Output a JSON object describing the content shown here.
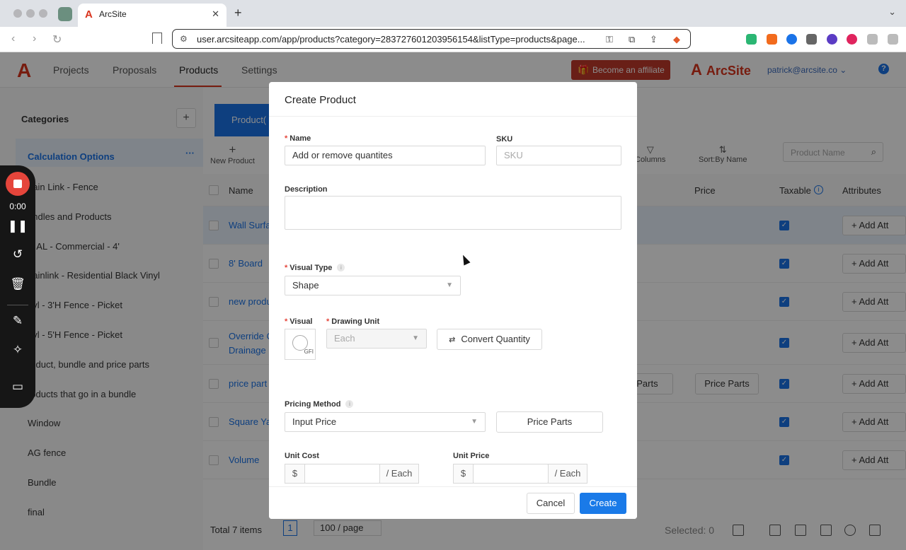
{
  "browser": {
    "tab_title": "ArcSite",
    "url": "user.arcsiteapp.com/app/products?category=283727601203956154&listType=products&page...",
    "tab_close": "✕",
    "new_tab": "+",
    "collapse_chevron": "⌄"
  },
  "app": {
    "logo": "A",
    "nav": [
      "Projects",
      "Proposals",
      "Products",
      "Settings"
    ],
    "active_nav": "Products",
    "affiliate_label": "Become an affiliate",
    "brand": "ArcSite",
    "user": "patrick@arcsite.co",
    "help": "?"
  },
  "sidebar": {
    "title": "Categories",
    "add": "+",
    "more": "···",
    "items": [
      {
        "label": "Calculation Options",
        "active": true
      },
      {
        "label": "hain Link - Fence"
      },
      {
        "label": "undles and Products"
      },
      {
        "label": "R AL - Commercial - 4'"
      },
      {
        "label": "hainlink - Residential Black Vinyl"
      },
      {
        "label": "nyl - 3'H Fence - Picket"
      },
      {
        "label": "nyl - 5'H Fence - Picket"
      },
      {
        "label": "roduct, bundle and price parts"
      },
      {
        "label": "roducts that go in a bundle"
      },
      {
        "label": "Window"
      },
      {
        "label": "AG fence"
      },
      {
        "label": "Bundle"
      },
      {
        "label": "final"
      }
    ]
  },
  "main": {
    "product_tab": "Product(",
    "tools": {
      "new_product": "New Product",
      "columns": "Columns",
      "sort": "Sort:By Name"
    },
    "search_placeholder": "Product Name",
    "headers": {
      "name": "Name",
      "price": "Price",
      "taxable": "Taxable",
      "attributes": "Attributes"
    },
    "rows": [
      {
        "name": "Wall Surfa",
        "highlight": true
      },
      {
        "name": "8' Board"
      },
      {
        "name": "new produ"
      },
      {
        "name": "Override C",
        "name2": "Drainage I"
      },
      {
        "name": "price part",
        "price_parts": true
      },
      {
        "name": "Square Ya"
      },
      {
        "name": "Volume"
      }
    ],
    "add_att": "+ Add Att",
    "price_parts_label": "Price Parts",
    "price_parts_partial": "e Parts",
    "footer": {
      "total": "Total 7 items",
      "page": "1",
      "per_page": "100 / page",
      "selected": "Selected: 0"
    }
  },
  "recorder": {
    "time": "0:00"
  },
  "modal": {
    "title": "Create Product",
    "name_label": "Name",
    "name_value": "Add or remove quantites",
    "sku_label": "SKU",
    "sku_placeholder": "SKU",
    "description_label": "Description",
    "visual_type_label": "Visual Type",
    "visual_type_value": "Shape",
    "visual_label": "Visual",
    "visual_thumb_text": "GFI",
    "drawing_unit_label": "Drawing Unit",
    "drawing_unit_value": "Each",
    "convert_label": "Convert Quantity",
    "pricing_method_label": "Pricing Method",
    "pricing_method_value": "Input Price",
    "price_parts_label": "Price Parts",
    "unit_cost_label": "Unit Cost",
    "unit_price_label": "Unit Price",
    "currency": "$",
    "per_unit": "/ Each",
    "cancel_label": "Cancel",
    "create_label": "Create",
    "info_mark": "i",
    "required_mark": "*"
  },
  "colors": {
    "accent": "#1a73e8",
    "brand": "#d9331d",
    "record": "#e5453b"
  }
}
